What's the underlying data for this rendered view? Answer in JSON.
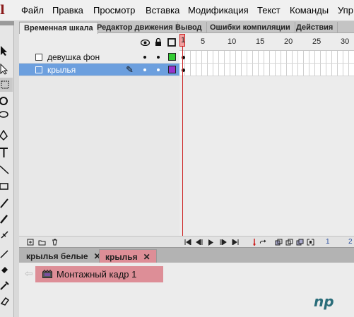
{
  "app": {
    "logo_letter": "l"
  },
  "menu": [
    "Файл",
    "Правка",
    "Просмотр",
    "Вставка",
    "Модификация",
    "Текст",
    "Команды",
    "Упр"
  ],
  "panel_tabs": [
    "Временная шкала",
    "Редактор движения",
    "Вывод",
    "Ошибки компиляции",
    "Действия"
  ],
  "active_panel_tab": "Временная шкала",
  "timeline": {
    "current_frame": "1",
    "ruler_labels": [
      "5",
      "10",
      "15",
      "20",
      "25",
      "30"
    ],
    "layers": [
      {
        "name": "девушка фон",
        "selected": false,
        "outline_color": "#33cc33"
      },
      {
        "name": "крылья",
        "selected": true,
        "outline_color": "#9933cc"
      }
    ],
    "bottom_numbers": [
      "1",
      "2"
    ]
  },
  "document_tabs": [
    {
      "label": "крылья белые",
      "close": "✕",
      "active": false
    },
    {
      "label": "крылья",
      "close": "✕",
      "active": true
    }
  ],
  "stage": {
    "scene_label": "Монтажный кадр 1",
    "watermark": "np"
  },
  "colors": {
    "accent_pink": "#dd8e97",
    "selected_layer": "#6c9fde",
    "playhead": "#cc2020"
  }
}
